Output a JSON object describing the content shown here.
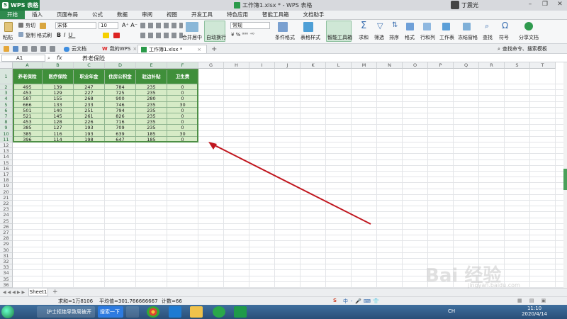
{
  "app": {
    "name": "WPS 表格",
    "doc_title": "工作簿1.xlsx * - WPS 表格",
    "user": "丁震光"
  },
  "menu": {
    "tabs": [
      "开始",
      "插入",
      "页面布局",
      "公式",
      "数据",
      "审阅",
      "视图",
      "开发工具",
      "特色应用",
      "智能工具箱",
      "文档助手"
    ]
  },
  "ribbon": {
    "paste": "粘贴",
    "cut": "剪切",
    "copy": "复制",
    "format_painter": "格式刷",
    "font_name": "宋体",
    "font_size": "10",
    "merge_center": "合并居中",
    "wrap_text": "自动换行",
    "number_format": "常规",
    "conditional_format": "条件格式",
    "table_style": "表格样式",
    "smart_toolbox": "智能工具箱",
    "sum": "求和",
    "filter": "筛选",
    "sort": "排序",
    "format": "格式",
    "row_col": "行和列",
    "worksheet": "工作表",
    "freeze": "冻结窗格",
    "find": "查找",
    "symbol": "符号",
    "share": "分享文档"
  },
  "qbar": {
    "cloud_tab": "云文档",
    "my_wps_tab": "我的WPS",
    "workbook_tab": "工作簿1.xlsx *",
    "search_placeholder": "查找命令、搜索模板"
  },
  "formula_bar": {
    "cell_ref": "A1",
    "fx": "fx",
    "content": "养老保险"
  },
  "grid": {
    "columns": [
      "A",
      "B",
      "C",
      "D",
      "E",
      "F",
      "G",
      "H",
      "I",
      "J",
      "K",
      "L",
      "M",
      "N",
      "O",
      "P",
      "Q",
      "R",
      "S",
      "T"
    ],
    "row_count": 38,
    "table_headers": [
      "养老保险",
      "医疗保险",
      "职业年金",
      "住房公积金",
      "驻边补贴",
      "卫生费"
    ],
    "table_rows": [
      [
        "495",
        "139",
        "247",
        "784",
        "235",
        "0"
      ],
      [
        "453",
        "129",
        "227",
        "725",
        "235",
        "0"
      ],
      [
        "587",
        "155",
        "268",
        "900",
        "280",
        "0"
      ],
      [
        "666",
        "133",
        "233",
        "746",
        "235",
        "30"
      ],
      [
        "501",
        "140",
        "251",
        "794",
        "235",
        "0"
      ],
      [
        "521",
        "145",
        "261",
        "826",
        "235",
        "0"
      ],
      [
        "453",
        "128",
        "226",
        "716",
        "235",
        "0"
      ],
      [
        "385",
        "127",
        "193",
        "709",
        "235",
        "0"
      ],
      [
        "385",
        "116",
        "193",
        "639",
        "185",
        "30"
      ],
      [
        "396",
        "114",
        "198",
        "647",
        "185",
        "0"
      ]
    ]
  },
  "sheets": {
    "tabs": [
      "Sheet1"
    ],
    "add": "+"
  },
  "status": {
    "sum": "求和=1万8106",
    "avg": "平均值=301.766666667",
    "count": "计数=66"
  },
  "taskbar": {
    "item1": "护士拒绝导致周被开",
    "search_btn": "搜索一下",
    "time": "11:10",
    "date": "2020/4/14",
    "ime": "CH"
  },
  "watermark": {
    "text": "Bai 经验",
    "sub": "jingyan.baidu.com"
  },
  "colors": {
    "brand": "#2f8a4e",
    "table_header": "#3f8f3a",
    "table_body": "#d6ebc6",
    "arrow": "#c0161e"
  }
}
